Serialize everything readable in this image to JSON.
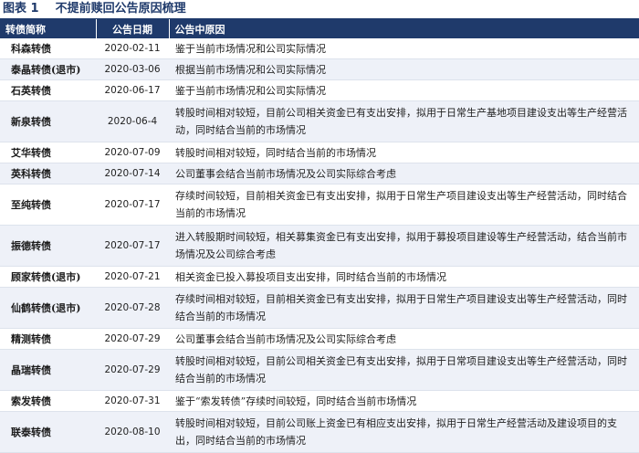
{
  "title": {
    "label": "图表 1",
    "text": "不提前赎回公告原因梳理"
  },
  "table": {
    "headers": [
      "转债简称",
      "公告日期",
      "公告中原因"
    ],
    "rows": [
      {
        "name": "科森转债",
        "date": "2020-02-11",
        "reason": "鉴于当前市场情况和公司实际情况"
      },
      {
        "name": "泰晶转债(退市)",
        "date": "2020-03-06",
        "reason": "根据当前市场情况和公司实际情况"
      },
      {
        "name": "石英转债",
        "date": "2020-06-17",
        "reason": "鉴于当前市场情况和公司实际情况"
      },
      {
        "name": "新泉转债",
        "date": "2020-06-4",
        "reason": "转股时间相对较短，目前公司相关资金已有支出安排，拟用于日常生产基地项目建设支出等生产经营活动，同时结合当前的市场情况"
      },
      {
        "name": "艾华转债",
        "date": "2020-07-09",
        "reason": "转股时间相对较短，同时结合当前的市场情况"
      },
      {
        "name": "英科转债",
        "date": "2020-07-14",
        "reason": "公司董事会结合当前市场情况及公司实际综合考虑"
      },
      {
        "name": "至纯转债",
        "date": "2020-07-17",
        "reason": "存续时间较短，目前相关资金已有支出安排，拟用于日常生产项目建设支出等生产经营活动，同时结合当前的市场情况"
      },
      {
        "name": "振德转债",
        "date": "2020-07-17",
        "reason": "进入转股期时间较短，相关募集资金已有支出安排，拟用于募投项目建设等生产经营活动，结合当前市场情况及公司综合考虑"
      },
      {
        "name": "顾家转债(退市)",
        "date": "2020-07-21",
        "reason": "相关资金已投入募投项目支出安排，同时结合当前的市场情况"
      },
      {
        "name": "仙鹤转债(退市)",
        "date": "2020-07-28",
        "reason": "存续时间相对较短，目前相关资金已有支出安排，拟用于日常生产项目建设支出等生产经营活动，同时结合当前的市场情况"
      },
      {
        "name": "精测转债",
        "date": "2020-07-29",
        "reason": "公司董事会结合当前市场情况及公司实际综合考虑"
      },
      {
        "name": "晶瑞转债",
        "date": "2020-07-29",
        "reason": "转股时间相对较短，目前公司相关资金已有支出安排，拟用于日常项目建设支出等生产经营活动，同时结合当前的市场情况"
      },
      {
        "name": "索发转债",
        "date": "2020-07-31",
        "reason": "鉴于“索发转债”存续时间较短，同时结合当前市场情况"
      },
      {
        "name": "联泰转债",
        "date": "2020-08-10",
        "reason": "转股时间相对较短，目前公司账上资金已有相应支出安排，拟用于日常生产经营活动及建设项目的支出，同时结合当前的市场情况"
      }
    ]
  }
}
